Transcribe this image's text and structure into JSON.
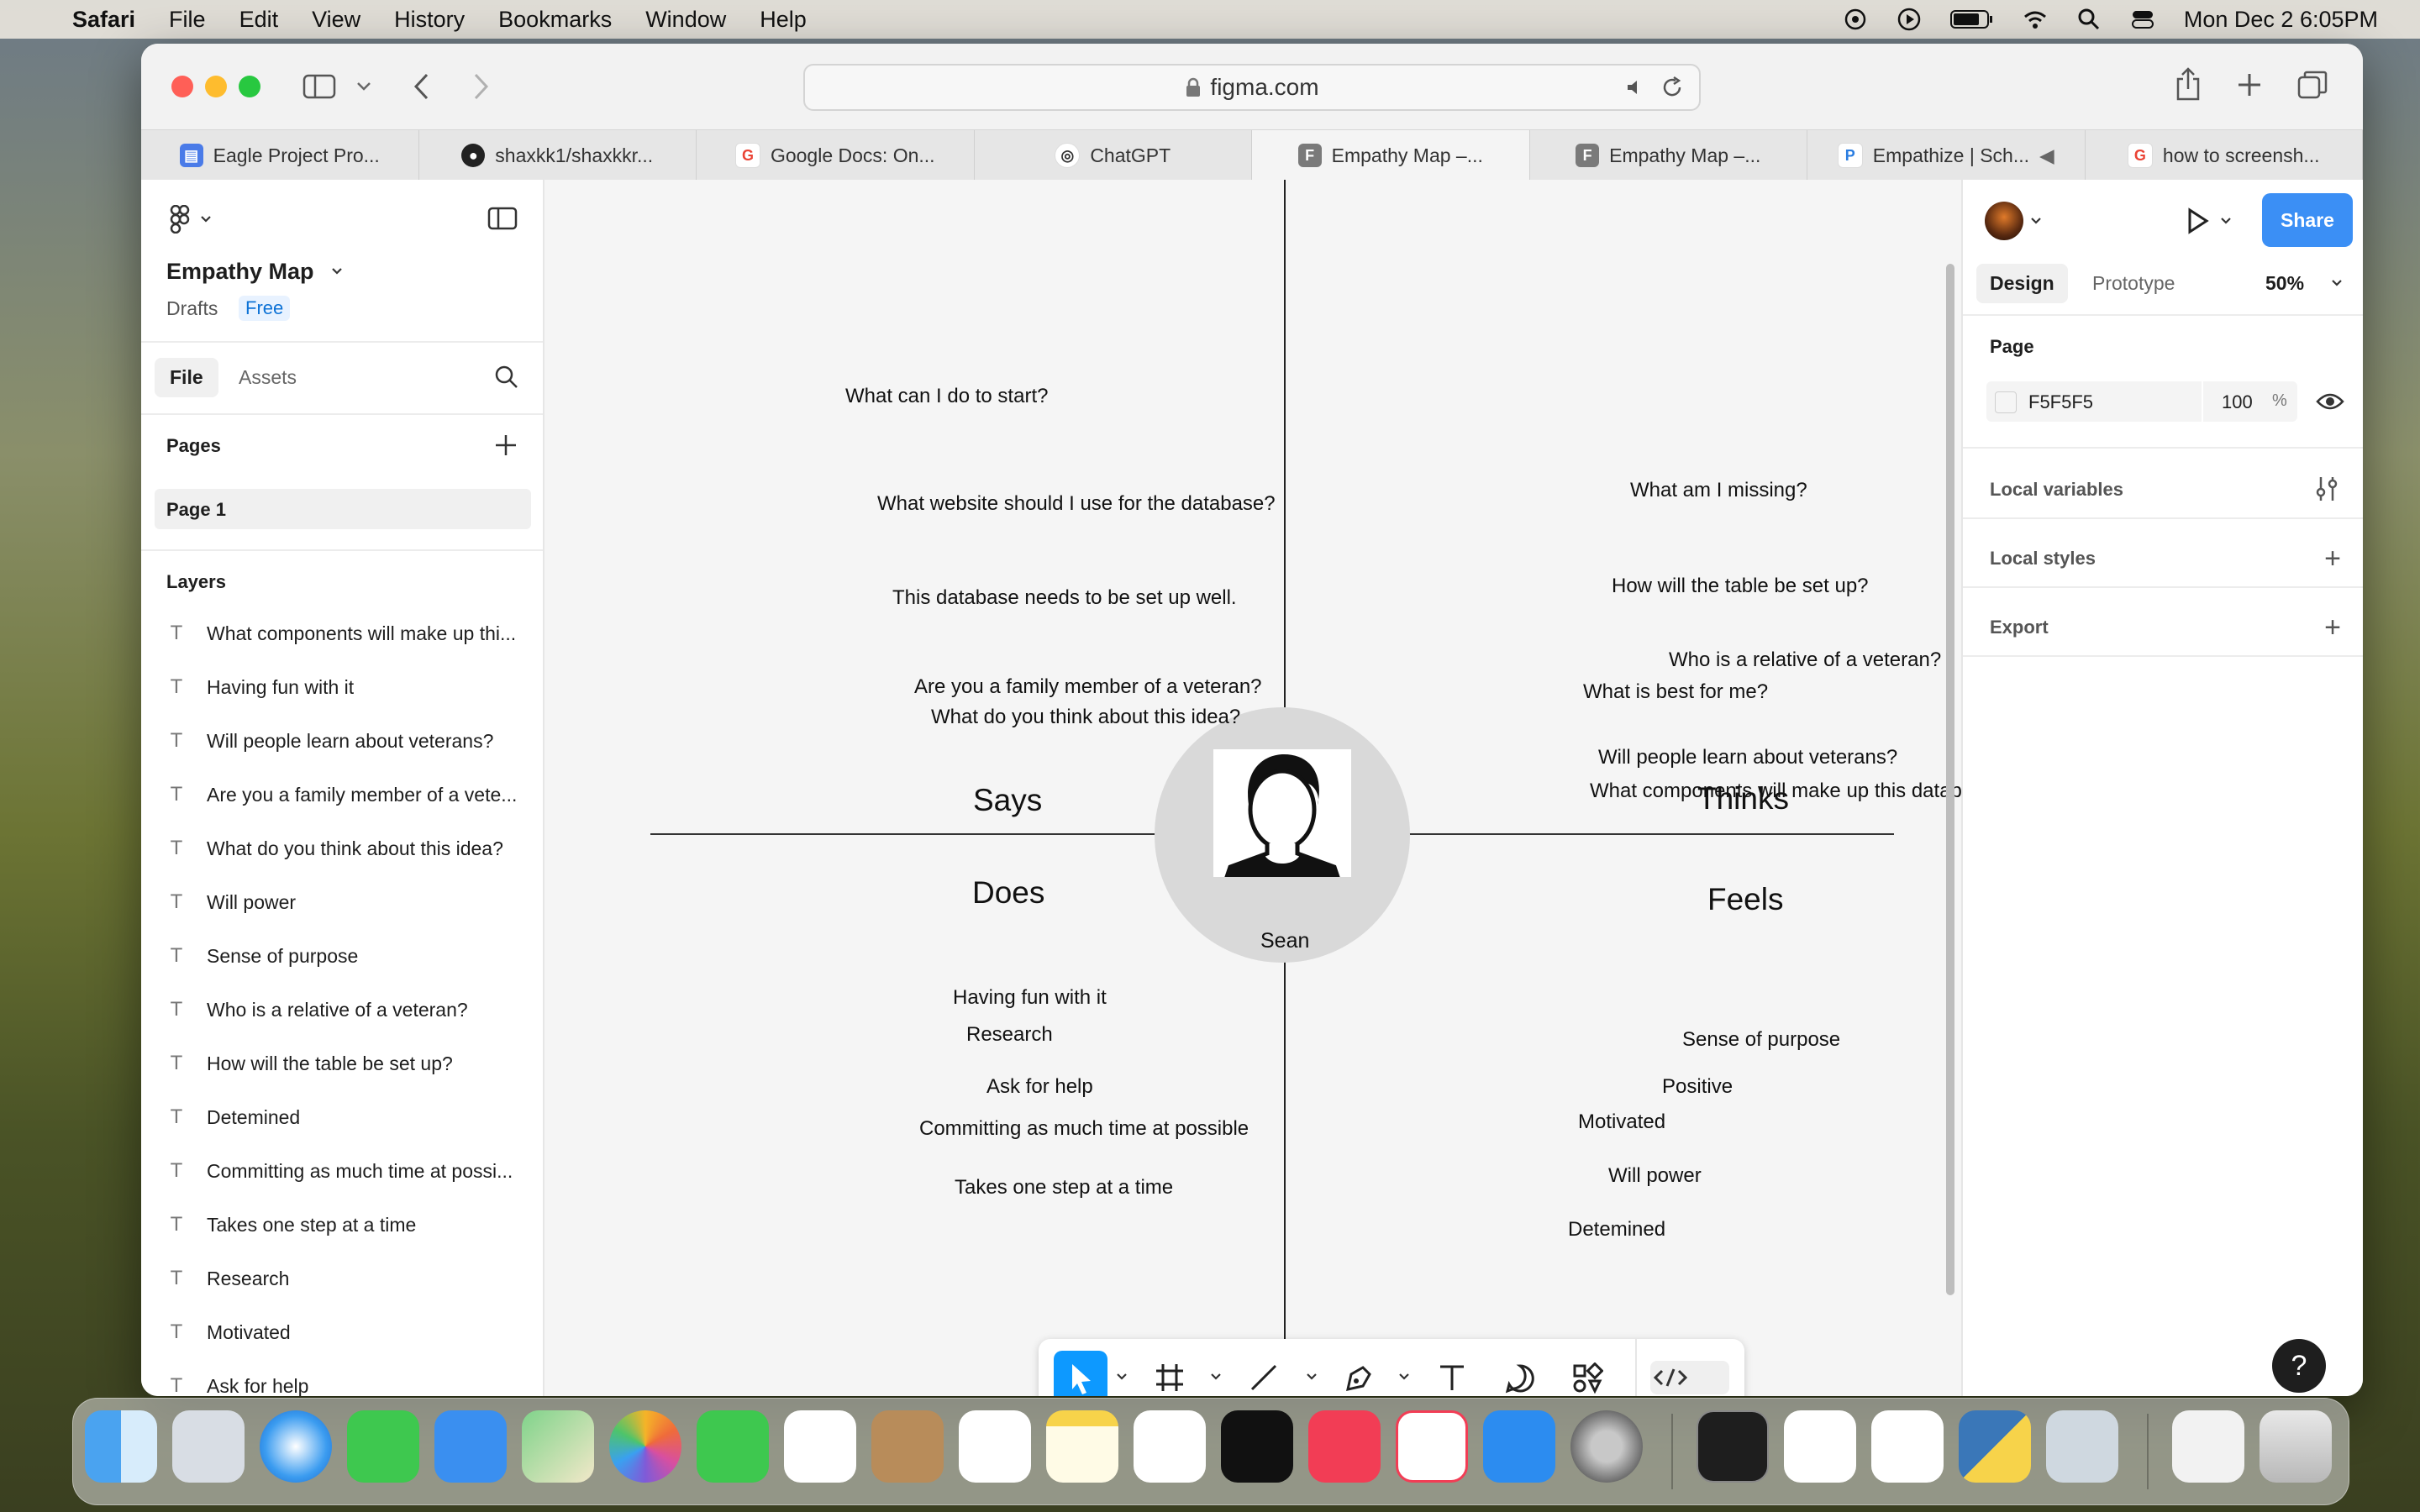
{
  "menubar": {
    "app": "Safari",
    "items": [
      "File",
      "Edit",
      "View",
      "History",
      "Bookmarks",
      "Window",
      "Help"
    ],
    "datetime": "Mon Dec 2  6:05PM"
  },
  "browser": {
    "address": "figma.com",
    "tabs": [
      {
        "label": "Eagle Project Pro...",
        "icon": "google-docs-icon",
        "color": "#4a7be8"
      },
      {
        "label": "shaxkk1/shaxkkr...",
        "icon": "github-icon",
        "color": "#222222"
      },
      {
        "label": "Google Docs: On...",
        "icon": "google-icon",
        "color": "#ea4335"
      },
      {
        "label": "ChatGPT",
        "icon": "chatgpt-icon",
        "color": "#333333"
      },
      {
        "label": "Empathy Map –...",
        "icon": "figma-icon",
        "color": "#7a7a7a"
      },
      {
        "label": "Empathy Map –...",
        "icon": "figma-icon",
        "color": "#7a7a7a"
      },
      {
        "label": "Empathize | Sch...",
        "icon": "paypal-icon",
        "color": "#2a7de1"
      },
      {
        "label": "how to screensh...",
        "icon": "google-icon",
        "color": "#ea4335"
      }
    ]
  },
  "figma": {
    "file_name": "Empathy Map",
    "location": "Drafts",
    "plan": "Free",
    "left_tabs": [
      "File",
      "Assets"
    ],
    "pages_title": "Pages",
    "pages": [
      "Page 1"
    ],
    "layers_title": "Layers",
    "layers": [
      "What components will make up thi...",
      "Having fun with it",
      "Will people learn about veterans?",
      "Are you a family member of a vete...",
      "What do you think about this idea?",
      "Will power",
      "Sense of purpose",
      "Who is a relative of a veteran?",
      "How will the table be set up?",
      "Detemined",
      "Committing as much time at possi...",
      "Takes one step at a time",
      "Research",
      "Motivated",
      "Ask for help"
    ],
    "right": {
      "tabs": [
        "Design",
        "Prototype"
      ],
      "zoom": "50%",
      "share": "Share",
      "page_label": "Page",
      "bg_hex": "F5F5F5",
      "bg_opacity": "100",
      "percent": "%",
      "local_variables": "Local variables",
      "local_styles": "Local styles",
      "export": "Export",
      "bg_color": "#F5F5F5"
    }
  },
  "canvas": {
    "center_name": "Sean",
    "quadrant_titles": {
      "says": "Says",
      "thinks": "Thinks",
      "does": "Does",
      "feels": "Feels"
    },
    "says": [
      "What can I do to start?",
      "What website should I use for the database?",
      "This database needs to be set up well.",
      "Are you a family member of a veteran?",
      "What do you think about this idea?"
    ],
    "thinks": [
      "What am I missing?",
      "How will the table be set up?",
      "Who is a relative of a veteran?",
      "What is best for me?",
      "Will people learn about veterans?",
      "What components will make up this database?"
    ],
    "does": [
      "Having fun with it",
      "Research",
      "Ask for help",
      "Committing as much time at possible",
      "Takes one step at a time"
    ],
    "feels": [
      "Sense of purpose",
      "Positive",
      "Motivated",
      "Will power",
      "Detemined"
    ]
  },
  "colors": {
    "figma_blue": "#0d99ff",
    "share_blue": "#3b8ff5"
  }
}
